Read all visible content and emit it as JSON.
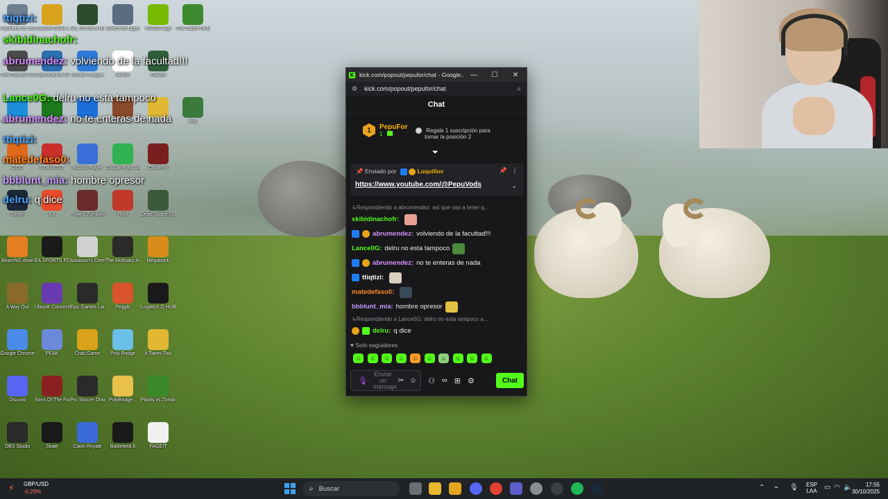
{
  "desktop_icons": [
    {
      "label": "Papelera de reciclaje",
      "icon": "recycle-bin-icon",
      "color": "#6f7f8f"
    },
    {
      "label": "Counter-Strike 2",
      "icon": "counter-strike-icon",
      "color": "#d9a21b"
    },
    {
      "label": "No, I'm not a Human",
      "icon": "no-im-not-a-human-icon",
      "color": "#2c4a2c"
    },
    {
      "label": "Switch de Ligas",
      "icon": "switch-de-ligas-icon",
      "color": "#5b6c82"
    },
    {
      "label": "NVIDIA App",
      "icon": "nvidia-icon",
      "color": "#76b900"
    },
    {
      "label": "The Cabin Factory",
      "icon": "cabin-factory-icon",
      "color": "#3c8a2e"
    },
    {
      "label": "Tom Clancy's Rainbow Six",
      "icon": "rainbow-six-icon",
      "color": "#4a4a4a"
    },
    {
      "label": "Supermarket Simulator",
      "icon": "supermarket-icon",
      "color": "#2c6fb0"
    },
    {
      "label": "Rocket League",
      "icon": "rocket-league-icon",
      "color": "#2d7bd6"
    },
    {
      "label": "Notion",
      "icon": "notion-icon",
      "color": "#ffffff"
    },
    {
      "label": "Outlast",
      "icon": "outlast-icon",
      "color": "#2e5f3a"
    },
    {
      "label": "Microsoft Edge",
      "icon": "edge-icon",
      "color": "#1d8fd8"
    },
    {
      "label": "Xbox App",
      "icon": "xbox-icon",
      "color": "#1b7a1b"
    },
    {
      "label": "Roblox Studio",
      "icon": "roblox-studio-icon",
      "color": "#1b6fd9"
    },
    {
      "label": "vintage Ga...",
      "icon": "vintage-game-icon",
      "color": "#8a4a2a"
    },
    {
      "label": "vintage Ga...",
      "icon": "vintage-game-icon",
      "color": "#e0b833"
    },
    {
      "label": "img",
      "icon": "image-icon",
      "color": "#3a7a3a"
    },
    {
      "label": "GGC",
      "icon": "ggc-icon",
      "color": "#e06a1a"
    },
    {
      "label": "STRAFTAT",
      "icon": "straftat-icon",
      "color": "#c9302c"
    },
    {
      "label": "Roblox Player",
      "icon": "roblox-player-icon",
      "color": "#3a6fd9"
    },
    {
      "label": "Google Play Juegos Beta",
      "icon": "google-play-games-icon",
      "color": "#2fb24f"
    },
    {
      "label": "CloverPit",
      "icon": "cloverpit-icon",
      "color": "#7a1f1f"
    },
    {
      "label": "Steam",
      "icon": "steam-icon",
      "color": "#1b2838"
    },
    {
      "label": "EA",
      "icon": "ea-icon",
      "color": "#e84a2a"
    },
    {
      "label": "Project Zomboid",
      "icon": "project-zomboid-icon",
      "color": "#6a2a2a"
    },
    {
      "label": "Rust",
      "icon": "rust-icon",
      "color": "#c0392b"
    },
    {
      "label": "Dead Space (2023)",
      "icon": "dead-space-icon",
      "color": "#3a5a3a"
    },
    {
      "label": "BeamNG.drive",
      "icon": "beamng-icon",
      "color": "#e67e22"
    },
    {
      "label": "EA SPORTS FC 26",
      "icon": "ea-fc-icon",
      "color": "#1a1a1a"
    },
    {
      "label": "Assassin's Creed I",
      "icon": "assassins-creed-icon",
      "color": "#d0d0d0"
    },
    {
      "label": "The Mortuary Assistant",
      "icon": "mortuary-assistant-icon",
      "color": "#2a2a2a"
    },
    {
      "label": "Megabonk",
      "icon": "megabonk-icon",
      "color": "#d98c1a"
    },
    {
      "label": "A Way Out",
      "icon": "a-way-out-icon",
      "color": "#8a6a2a"
    },
    {
      "label": "Ubisoft Connect",
      "icon": "ubisoft-icon",
      "color": "#6a3ab0"
    },
    {
      "label": "Epic Games Launcher",
      "icon": "epic-games-icon",
      "color": "#2a2a2a"
    },
    {
      "label": "Peggle",
      "icon": "peggle-icon",
      "color": "#d9532b"
    },
    {
      "label": "Logitech G HUB",
      "icon": "logitech-icon",
      "color": "#1a1a1a"
    },
    {
      "label": "Google Chrome",
      "icon": "chrome-icon",
      "color": "#4a8ae8"
    },
    {
      "label": "PEAK",
      "icon": "peak-icon",
      "color": "#6a8ad9"
    },
    {
      "label": "Crab Game",
      "icon": "crab-game-icon",
      "color": "#d9a21b"
    },
    {
      "label": "Poly Bridge",
      "icon": "poly-bridge-icon",
      "color": "#6ac0e8"
    },
    {
      "label": "It Takes Two",
      "icon": "it-takes-two-icon",
      "color": "#e0b833"
    },
    {
      "label": "Discord",
      "icon": "discord-icon",
      "color": "#5865f2"
    },
    {
      "label": "Sons Of The Forest",
      "icon": "sons-of-the-forest-icon",
      "color": "#8a1f1f"
    },
    {
      "label": "Pro Soccer Online",
      "icon": "pro-soccer-icon",
      "color": "#2a2a2a"
    },
    {
      "label": "PolyBridge...",
      "icon": "folder-icon",
      "color": "#e8c04a"
    },
    {
      "label": "Plants vs Zombies Tr...",
      "icon": "pvz-icon",
      "color": "#3a8a2a"
    },
    {
      "label": "OBS Studio",
      "icon": "obs-icon",
      "color": "#2a2a2a"
    },
    {
      "label": "Skate",
      "icon": "skate-icon",
      "color": "#1a1a1a"
    },
    {
      "label": "Clash Royale",
      "icon": "clash-royale-icon",
      "color": "#3a6ad9"
    },
    {
      "label": "Battlefield 6",
      "icon": "battlefield-icon",
      "color": "#1a1a1a"
    },
    {
      "label": "FAGEIT",
      "icon": "file-icon",
      "color": "#f0f0f0"
    }
  ],
  "overlay_chat": [
    {
      "user": "ttiqtizi:",
      "text": "",
      "color": "#4aa3ff"
    },
    {
      "user": "skibidinachofr:",
      "text": "",
      "color": "#53fc18"
    },
    {
      "user": "abrumendez:",
      "text": "volviendo de la facultad!!!",
      "color": "#d88fff"
    },
    {
      "user": "Lance0G:",
      "text": "delru no esta tampoco",
      "color": "#53fc18"
    },
    {
      "user": "abrumendez:",
      "text": "no te enteras de nada",
      "color": "#d88fff"
    },
    {
      "user": "ttiqtizi:",
      "text": "",
      "color": "#4aa3ff"
    },
    {
      "user": "matedefaso0:",
      "text": "",
      "color": "#ff8a2a"
    },
    {
      "user": "bbblunt_mia:",
      "text": "hombre opresor",
      "color": "#c79bff"
    },
    {
      "user": "delru:",
      "text": "q dice",
      "color": "#4aa3ff"
    }
  ],
  "window": {
    "title": "kick.com/popout/pepufor/chat - Google...",
    "url": "kick.com/popout/pepufor/chat",
    "minimize": "—",
    "maximize": "☐",
    "close": "✕"
  },
  "chat": {
    "header": "Chat",
    "leader": {
      "rank": "1",
      "name": "PepuFor",
      "count": "1"
    },
    "gift_text_1": "Regala 1 suscripción para",
    "gift_text_2": "tomar la posición 2",
    "pinned": {
      "sent_by_label": "Enviado por",
      "user": "Luquillov",
      "link": "https://www.youtube.com/@PepuVods"
    },
    "messages": [
      {
        "kind": "reply",
        "text": "Respondiendo a abrumendez: así que vas a tener q..."
      },
      {
        "kind": "msg",
        "user": "skibidinachofr:",
        "text": "",
        "color": "#53fc18",
        "badges": [],
        "emote": "#e8a090"
      },
      {
        "kind": "msg",
        "user": "abrumendez:",
        "text": "volviendo de la facultad!!!",
        "color": "#d88fff",
        "badges": [
          "blue",
          "gold"
        ]
      },
      {
        "kind": "msg",
        "user": "Lance0G:",
        "text": "delru no esta tampoco",
        "color": "#53fc18",
        "badges": [],
        "emote": "#4a8a3a"
      },
      {
        "kind": "msg",
        "user": "abrumendez:",
        "text": "no te enteras de nada",
        "color": "#d88fff",
        "badges": [
          "blue",
          "gold"
        ]
      },
      {
        "kind": "msg",
        "user": "ttiqtizi:",
        "text": "",
        "color": "#ffffff",
        "badges": [
          "blue"
        ],
        "emote": "#d9d0c0"
      },
      {
        "kind": "msg",
        "user": "matedefaso0:",
        "text": "",
        "color": "#ff8a2a",
        "badges": [],
        "emote": "#3a4a5a"
      },
      {
        "kind": "msg",
        "user": "bbblunt_mia:",
        "text": "hombre opresor",
        "color": "#c79bff",
        "badges": [],
        "emote": "#e0c040"
      },
      {
        "kind": "reply",
        "text": "Respondiendo a Lance0G: delru no esta tampoco a..."
      },
      {
        "kind": "msg",
        "user": "delru:",
        "text": "q dice",
        "color": "#53fc18",
        "badges": [
          "gold",
          "green"
        ]
      }
    ],
    "followers_only": "Solo seguidores",
    "input_placeholder": "Enviar un mensaje",
    "send_button": "Chat"
  },
  "taskbar": {
    "weather_pair": "GBP/USD",
    "weather_change": "-0,29%",
    "search_text": "Buscar",
    "lang_1": "ESP",
    "lang_2": "LAA",
    "time": "17:55",
    "date": "30/10/2025"
  },
  "colors": {
    "kick_green": "#53fc18",
    "chat_bg": "#18181b",
    "taskbar_bg": "#1f2326"
  }
}
